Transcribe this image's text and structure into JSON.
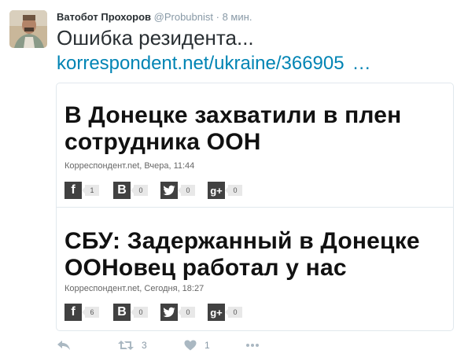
{
  "tweet": {
    "author_name": "Ватобот Прохоров",
    "handle": "@Probubnist",
    "dot": "·",
    "time": "8 мин.",
    "text": "Ошибка резидента...",
    "link_text": "korrespondent.net/ukraine/366905",
    "link_ellipsis": "…"
  },
  "card": {
    "articles": [
      {
        "title": "В Донецке захватили в плен сотрудника ООН",
        "meta": "Корреспондент.net, Вчера, 11:44",
        "shares": {
          "facebook": "1",
          "vk": "0",
          "twitter": "0",
          "gplus": "0"
        }
      },
      {
        "title": "СБУ: Задержанный в Донецке ООНовец работал у нас",
        "meta": "Корреспондент.net, Сегодня, 18:27",
        "shares": {
          "facebook": "6",
          "vk": "0",
          "twitter": "0",
          "gplus": "0"
        }
      }
    ]
  },
  "actions": {
    "retweet_count": "3",
    "like_count": "1"
  },
  "icons": {
    "avatar": "avatar-photo",
    "reply": "reply-icon",
    "retweet": "retweet-icon",
    "like": "heart-icon",
    "more": "more-icon",
    "facebook": "facebook-icon",
    "vk": "vk-icon",
    "twitter": "twitter-icon",
    "gplus": "gplus-icon"
  },
  "colors": {
    "link": "#0084b4",
    "muted": "#8899a6",
    "action": "#aab8c2",
    "share_icon_bg": "#414141"
  }
}
